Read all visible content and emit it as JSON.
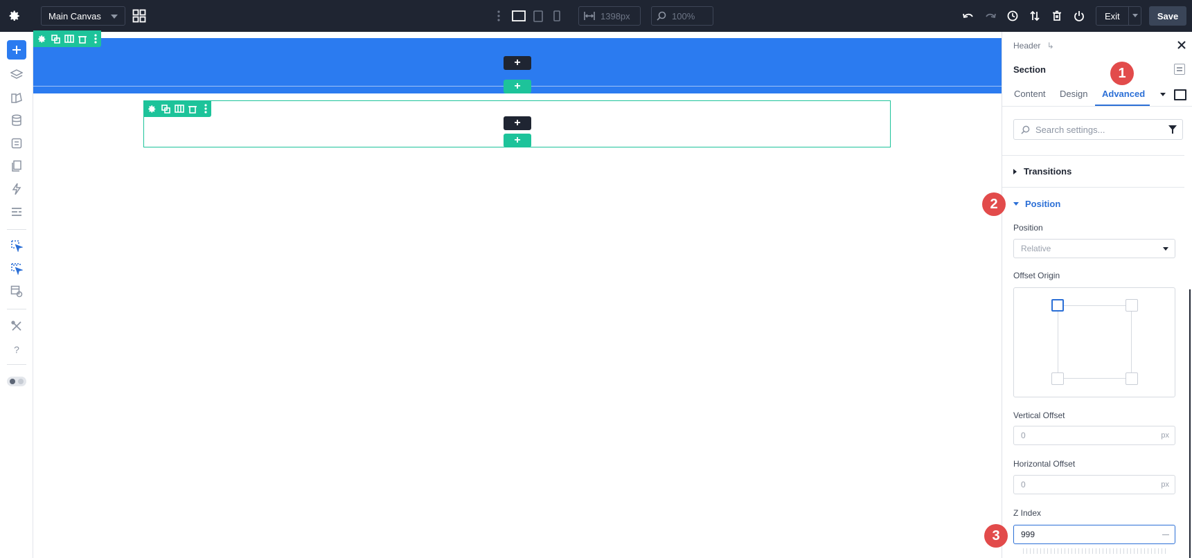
{
  "topbar": {
    "canvas_select": "Main Canvas",
    "width_value": "1398px",
    "zoom_value": "100%",
    "exit_label": "Exit",
    "save_label": "Save"
  },
  "panel": {
    "breadcrumb": "Header",
    "title": "Section",
    "tabs": [
      "Content",
      "Design",
      "Advanced"
    ],
    "active_tab": "Advanced",
    "search_placeholder": "Search settings...",
    "groups": {
      "transitions": "Transitions",
      "position": "Position"
    },
    "fields": {
      "position_label": "Position",
      "position_value": "Relative",
      "offset_origin_label": "Offset Origin",
      "vertical_offset_label": "Vertical Offset",
      "vertical_offset_value": "0",
      "vertical_offset_unit": "px",
      "horizontal_offset_label": "Horizontal Offset",
      "horizontal_offset_value": "0",
      "horizontal_offset_unit": "px",
      "z_index_label": "Z Index",
      "z_index_value": "999"
    }
  },
  "badges": [
    "1",
    "2",
    "3"
  ],
  "colors": {
    "topbar_bg": "#1f2532",
    "section_blue": "#2b7bf0",
    "row_green": "#1dc39a",
    "accent_blue": "#2b6fd6",
    "badge_red": "#e24b4b"
  }
}
